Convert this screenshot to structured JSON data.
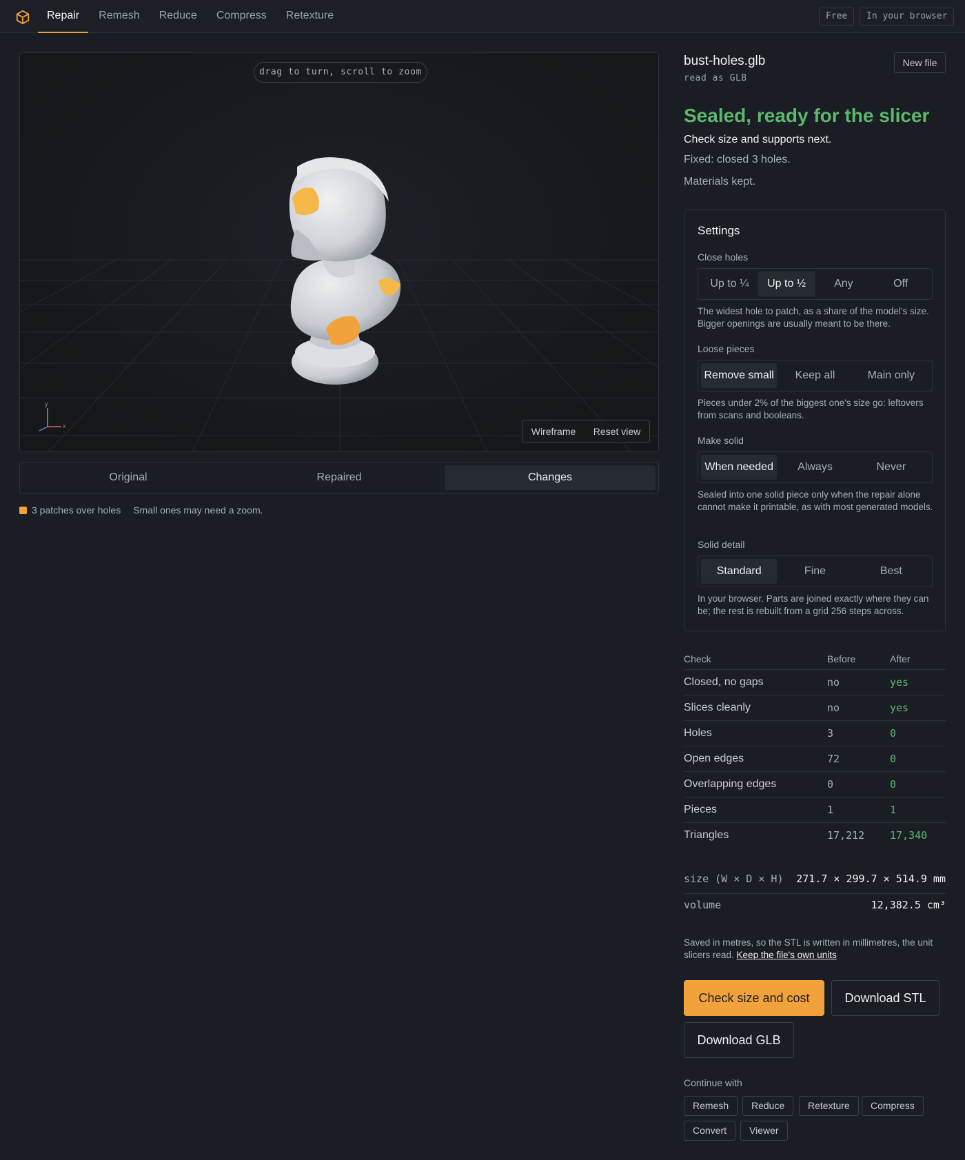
{
  "nav": {
    "items": [
      "Repair",
      "Remesh",
      "Reduce",
      "Compress",
      "Retexture"
    ],
    "active": "Repair",
    "badges": [
      "Free",
      "In your browser"
    ]
  },
  "viewer": {
    "hint": "drag to turn, scroll to zoom",
    "wireframe_label": "Wireframe",
    "reset_label": "Reset view",
    "axis_x": "x",
    "axis_y": "y",
    "patch_color": "#f2a23a"
  },
  "modes": {
    "items": [
      "Original",
      "Repaired",
      "Changes"
    ],
    "active": "Changes"
  },
  "legend": {
    "label": "3 patches over holes",
    "note": "Small ones may need a zoom."
  },
  "file": {
    "name": "bust-holes.glb",
    "read_as": "read as GLB",
    "new_file_label": "New file"
  },
  "result": {
    "status": "Sealed, ready for the slicer",
    "status_color": "#5cb86a",
    "next": "Check size and supports next.",
    "fixed": "Fixed: closed 3 holes.",
    "kept": "Materials kept."
  },
  "settings": {
    "title": "Settings",
    "close_holes": {
      "label": "Close holes",
      "options": [
        "Up to ¼",
        "Up to ½",
        "Any",
        "Off"
      ],
      "selected": "Up to ½",
      "help": "The widest hole to patch, as a share of the model's size. Bigger openings are usually meant to be there."
    },
    "loose_pieces": {
      "label": "Loose pieces",
      "options": [
        "Remove small",
        "Keep all",
        "Main only"
      ],
      "selected": "Remove small",
      "help": "Pieces under 2% of the biggest one's size go: leftovers from scans and booleans."
    },
    "make_solid": {
      "label": "Make solid",
      "options": [
        "When needed",
        "Always",
        "Never"
      ],
      "selected": "When needed",
      "help": "Sealed into one solid piece only when the repair alone cannot make it printable, as with most generated models."
    },
    "solid_detail": {
      "label": "Solid detail",
      "options": [
        "Standard",
        "Fine",
        "Best"
      ],
      "selected": "Standard",
      "help": "In your browser. Parts are joined exactly where they can be; the rest is rebuilt from a grid 256 steps across."
    }
  },
  "checks": {
    "headers": [
      "Check",
      "Before",
      "After"
    ],
    "rows": [
      [
        "Closed, no gaps",
        "no",
        "yes"
      ],
      [
        "Slices cleanly",
        "no",
        "yes"
      ],
      [
        "Holes",
        "3",
        "0"
      ],
      [
        "Open edges",
        "72",
        "0"
      ],
      [
        "Overlapping edges",
        "0",
        "0"
      ],
      [
        "Pieces",
        "1",
        "1"
      ],
      [
        "Triangles",
        "17,212",
        "17,340"
      ]
    ]
  },
  "dimensions": {
    "size_label": "size (W × D × H)",
    "size_value": "271.7 × 299.7 × 514.9 mm",
    "volume_label": "volume",
    "volume_value": "12,382.5 cm³"
  },
  "units": {
    "text": "Saved in metres, so the STL is written in millimetres, the unit slicers read.",
    "link": "Keep the file's own units"
  },
  "actions": {
    "primary": "Check size and cost",
    "stl": "Download STL",
    "glb": "Download GLB"
  },
  "continue": {
    "label": "Continue with",
    "items": [
      "Remesh",
      "Reduce",
      "Retexture",
      "Compress",
      "Convert",
      "Viewer"
    ]
  }
}
